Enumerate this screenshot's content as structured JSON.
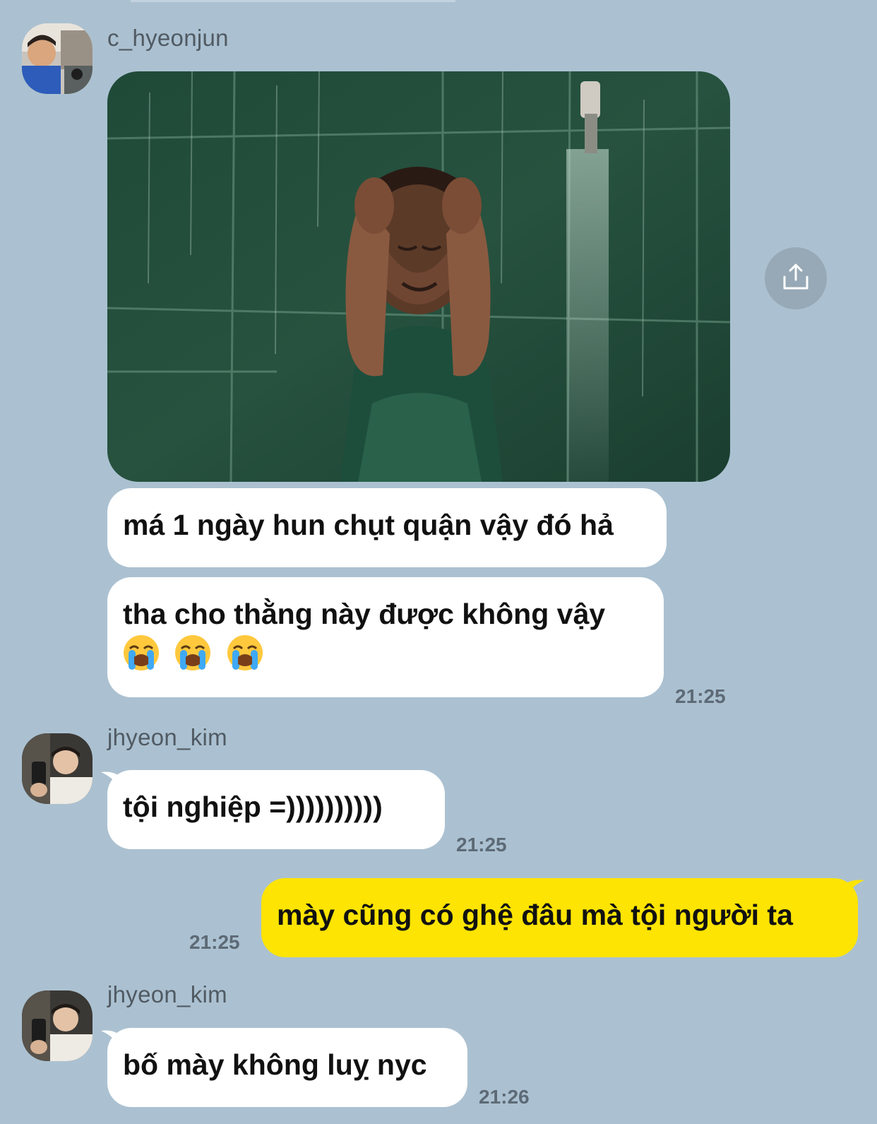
{
  "messages": [
    {
      "sender": "c_hyeonjun",
      "photo": {
        "icon": "crying-in-rain-photo"
      },
      "lines": [
        "má 1 ngày hun chụt quận vậy đó hả",
        "tha cho thằng này được không vậy"
      ],
      "emojis": [
        "😭",
        "😭",
        "😭"
      ],
      "time": "21:25"
    },
    {
      "sender": "jhyeon_kim",
      "text": "tội nghiệp =))))))))))",
      "time": "21:25"
    },
    {
      "sender": "me",
      "text": "mày cũng có ghệ đâu mà tội người ta",
      "time": "21:25"
    },
    {
      "sender": "jhyeon_kim",
      "text": "bố mày không luỵ nyc",
      "time": "21:26"
    }
  ],
  "colors": {
    "background": "#abc1d1",
    "incoming_bubble": "#ffffff",
    "outgoing_bubble": "#fde402"
  },
  "icons": {
    "share": "share-icon",
    "avatar1": "avatar",
    "avatar2": "avatar"
  }
}
